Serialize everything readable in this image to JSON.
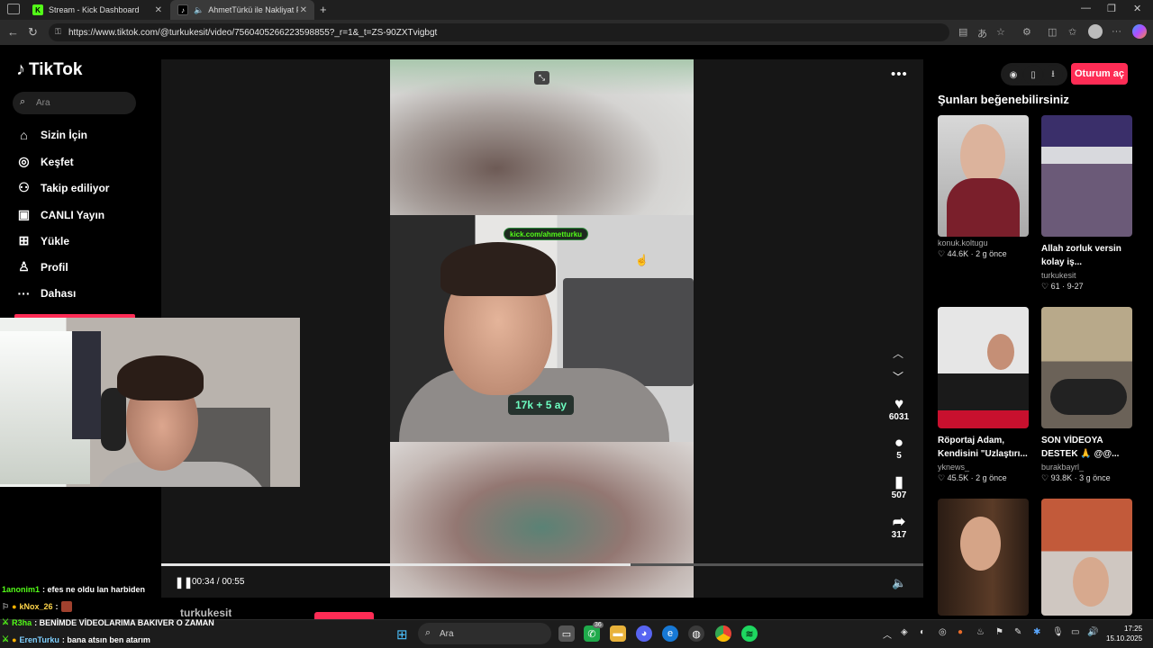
{
  "browser": {
    "tabs": [
      {
        "label": "Stream - Kick Dashboard",
        "icon": "kick-icon"
      },
      {
        "label": "AhmetTürkü ile Nakliyat Pazı",
        "icon": "tiktok-icon"
      }
    ],
    "new_tab": "+",
    "url": "https://www.tiktok.com/@turkukesit/video/7560405266223598855?_r=1&_t=ZS-90ZXTvigbgt"
  },
  "sidebar": {
    "logo": "TikTok",
    "search_placeholder": "Ara",
    "items": [
      {
        "label": "Sizin İçin",
        "icon": "home-icon",
        "glyph": "⌂"
      },
      {
        "label": "Keşfet",
        "icon": "compass-icon",
        "glyph": "◎"
      },
      {
        "label": "Takip ediliyor",
        "icon": "following-icon",
        "glyph": "⚇"
      },
      {
        "label": "CANLI Yayın",
        "icon": "live-tv-icon",
        "glyph": "▣"
      },
      {
        "label": "Yükle",
        "icon": "upload-icon",
        "glyph": "⊞"
      },
      {
        "label": "Profil",
        "icon": "profile-icon",
        "glyph": "♙"
      },
      {
        "label": "Dahası",
        "icon": "more-dots-icon",
        "glyph": "···"
      }
    ]
  },
  "video": {
    "overlay_link": "kick.com/ahmetturku",
    "overlay_caption": "17k + 5 ay",
    "author_partial": "turkukesit",
    "time": "00:34 / 00:55",
    "progress": 0.616
  },
  "actions": {
    "likes": "6031",
    "comments": "5",
    "saves": "507",
    "shares": "317"
  },
  "header": {
    "login": "Oturum aç"
  },
  "recommended": {
    "title": "Şunları beğenebilirsiniz",
    "cards": [
      {
        "title": "",
        "user": "konuk.koltugu",
        "meta": "♡ 44.6K · 2 g önce"
      },
      {
        "title": "Allah zorluk versin kolay iş...",
        "user": "turkukesit",
        "meta": "♡ 61 · 9-27"
      },
      {
        "title": "Röportaj Adam, Kendisini \"Uzlaştırı...",
        "user": "yknews_",
        "meta": "♡ 45.5K · 2 g önce"
      },
      {
        "title": "SON VİDEOYA DESTEK 🙏 @@...",
        "user": "burakbayrl_",
        "meta": "♡ 93.8K · 3 g önce"
      },
      {
        "title": "",
        "user": "",
        "meta": ""
      },
      {
        "title": "",
        "user": "",
        "meta": ""
      }
    ]
  },
  "chat": [
    {
      "user": "1anonim1",
      "text": ": efes ne oldu lan harbiden",
      "color": "#53fc18"
    },
    {
      "user": "kNox_26",
      "text": ":",
      "color": "#ffd54a"
    },
    {
      "user": "R3ha",
      "text": ": BENİMDE VİDEOLARIMA BAKIVER O ZAMAN",
      "color": "#53fc18"
    },
    {
      "user": "ErenTurku",
      "text": ": bana atsın ben atarım",
      "color": "#7fd0ff"
    }
  ],
  "taskbar": {
    "search": "Ara",
    "clock_time": "17:25",
    "clock_date": "15.10.2025",
    "badge": "36"
  },
  "colors": {
    "accent": "#fe2c55",
    "kick_green": "#53fc18"
  }
}
